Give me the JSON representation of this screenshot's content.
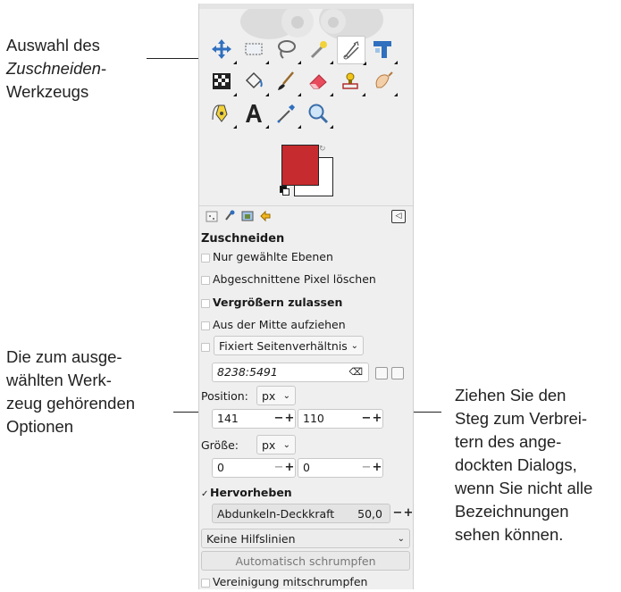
{
  "callouts": {
    "top_line1": "Auswahl des",
    "top_line2": "Zuschneiden",
    "top_line2_suffix": "-",
    "top_line3": "Werkzeugs",
    "left_line1": "Die zum ausge-",
    "left_line2": "wählten Werk-",
    "left_line3": "zeug gehörenden",
    "left_line4": "Optionen",
    "right_line1": "Ziehen Sie den",
    "right_line2": "Steg zum Verbrei-",
    "right_line3": "tern des ange-",
    "right_line4": "dockten Dialogs,",
    "right_line5": "wenn Sie nicht alle",
    "right_line6": "Bezeichnungen",
    "right_line7": "sehen können."
  },
  "toolbox": {
    "tools": [
      "move-icon",
      "rect-select-icon",
      "lasso-icon",
      "fuzzy-select-icon",
      "crop-icon",
      "align-icon",
      "warp-icon",
      "bucket-fill-icon",
      "paintbrush-icon",
      "eraser-icon",
      "clone-icon",
      "smudge-icon",
      "paths-icon",
      "text-icon",
      "color-picker-icon",
      "zoom-icon"
    ],
    "active_tool": "crop-icon",
    "fg_color": "#c62b2f",
    "bg_color": "#ffffff"
  },
  "options": {
    "title": "Zuschneiden",
    "only_selected_layers": "Nur gewählte Ebenen",
    "delete_cropped": "Abgeschnittene Pixel löschen",
    "allow_grow": "Vergrößern zulassen",
    "expand_center": "Aus der Mitte aufziehen",
    "fixed_label": "Fixiert Seitenverhältnis",
    "ratio_value": "8238:5491",
    "position_label": "Position:",
    "position_unit": "px",
    "position_x": "141",
    "position_y": "110",
    "size_label": "Größe:",
    "size_unit": "px",
    "size_w": "0",
    "size_h": "0",
    "highlight_label": "Hervorheben",
    "darken_label": "Abdunkeln-Deckkraft",
    "darken_value": "50,0",
    "guides": "Keine Hilfslinien",
    "auto_shrink": "Automatisch schrumpfen",
    "shrink_merged": "Vereinigung mitschrumpfen"
  },
  "glyphs": {
    "plus": "+",
    "minus": "−",
    "chevron": "⌄"
  }
}
